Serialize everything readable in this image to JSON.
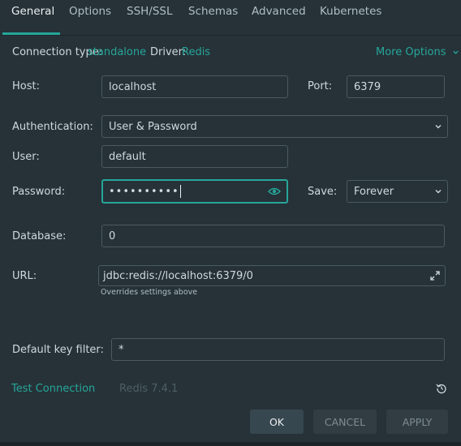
{
  "tabs": [
    "General",
    "Options",
    "SSH/SSL",
    "Schemas",
    "Advanced",
    "Kubernetes"
  ],
  "meta": {
    "conn_type_label": "Connection type:",
    "conn_type_value": "standalone",
    "driver_label": "Driver:",
    "driver_value": "Redis",
    "more_options": "More Options"
  },
  "form": {
    "host_label": "Host:",
    "host_value": "localhost",
    "port_label": "Port:",
    "port_value": "6379",
    "auth_label": "Authentication:",
    "auth_value": "User & Password",
    "user_label": "User:",
    "user_value": "default",
    "password_label": "Password:",
    "password_value": "••••••••••",
    "save_label": "Save:",
    "save_value": "Forever",
    "database_label": "Database:",
    "database_value": "0",
    "url_label": "URL:",
    "url_value": "jdbc:redis://localhost:6379/0",
    "url_hint": "Overrides settings above",
    "key_filter_label": "Default key filter:",
    "key_filter_value": "*"
  },
  "footer": {
    "test_connection": "Test Connection",
    "version": "Redis 7.4.1",
    "ok": "OK",
    "cancel": "CANCEL",
    "apply": "APPLY"
  },
  "icons": {
    "eye": "eye-icon",
    "expand": "expand-icon",
    "reset": "reset-icon",
    "chevron": "chevron-down-icon"
  },
  "colors": {
    "background": "#263238",
    "accent": "#26a69a",
    "text": "#cfd8dc",
    "muted": "#7f8c91"
  }
}
